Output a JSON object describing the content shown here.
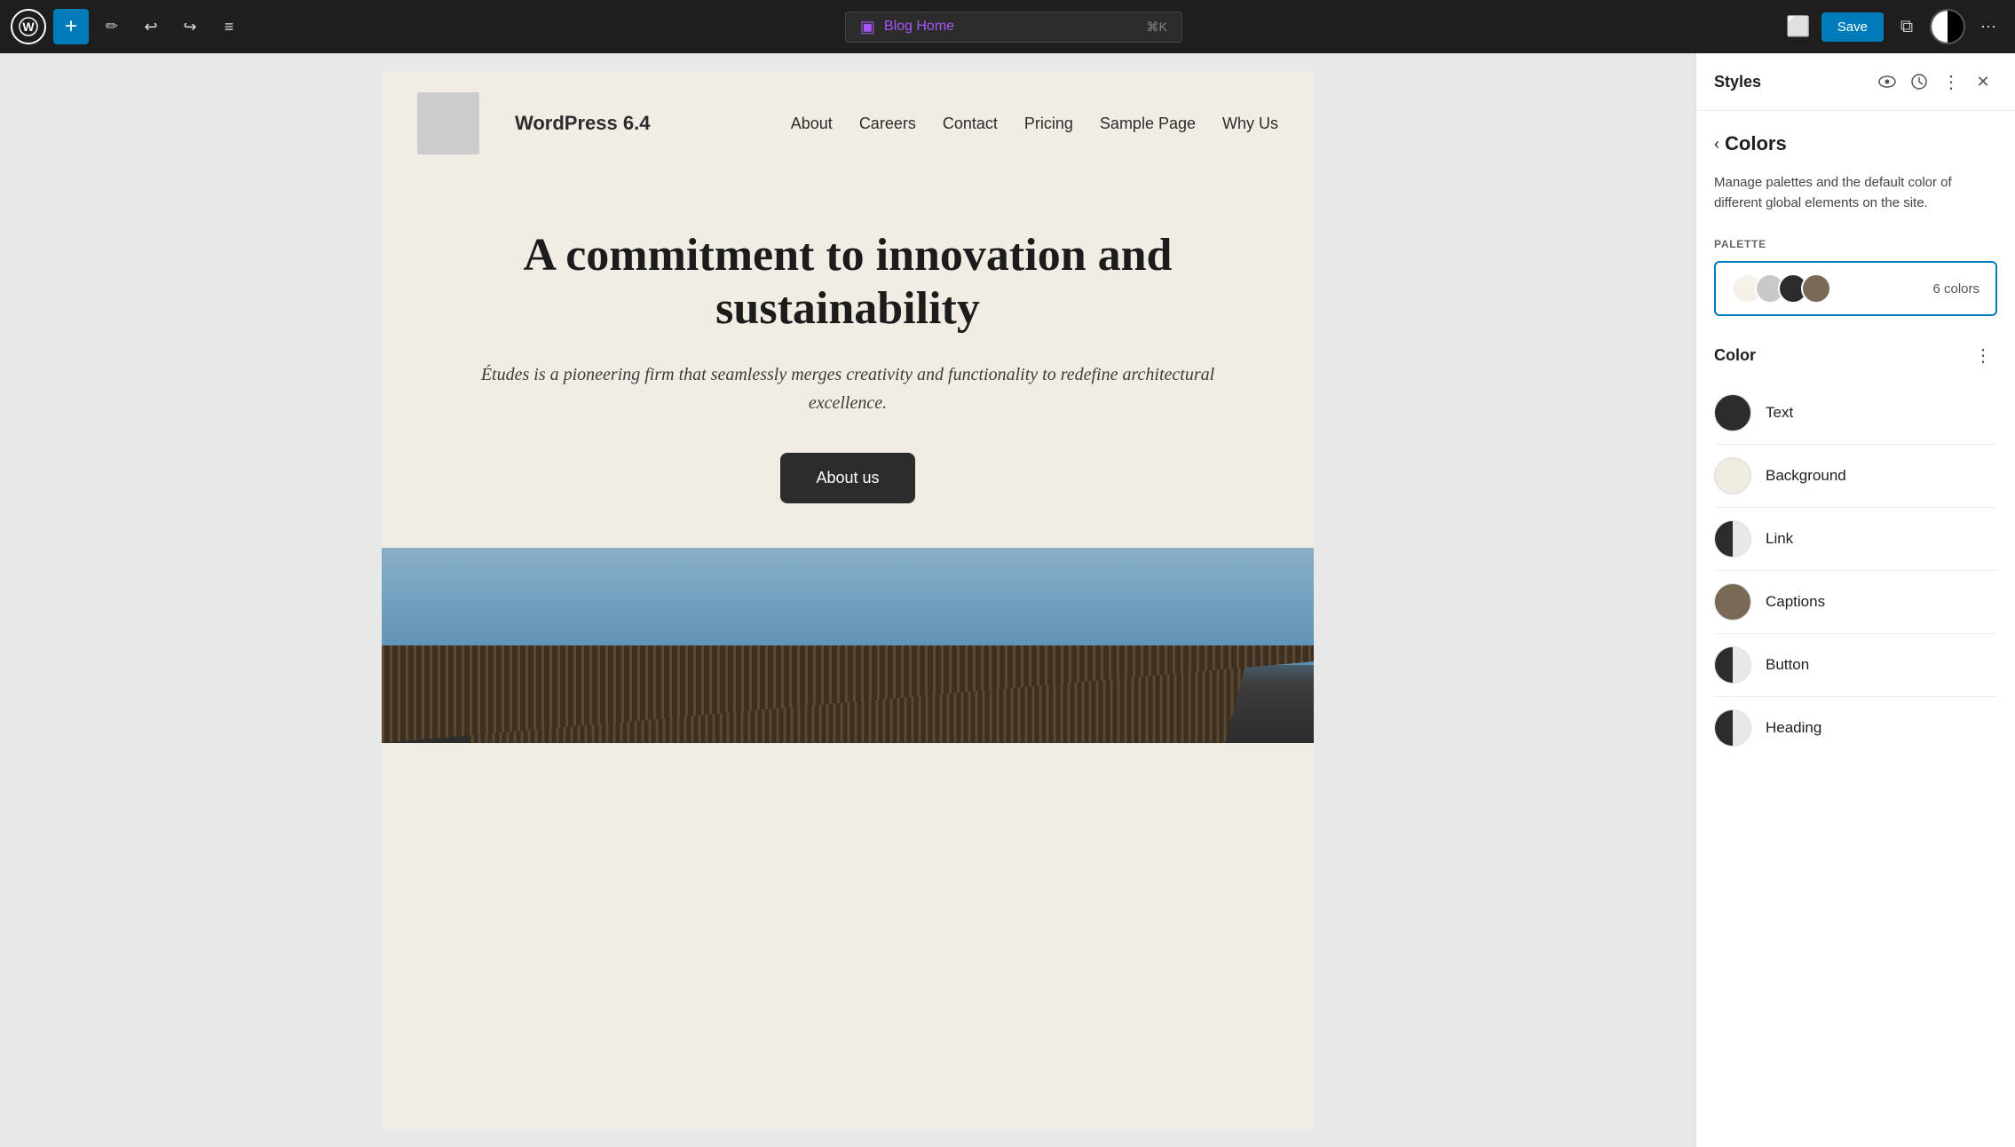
{
  "toolbar": {
    "wp_logo": "W",
    "add_label": "+",
    "url_icon": "▣",
    "url_text": "Blog Home",
    "url_shortcut": "⌘K",
    "save_label": "Save",
    "undo_icon": "↩",
    "redo_icon": "↪",
    "list_icon": "≡",
    "pen_icon": "✏",
    "desktop_icon": "□",
    "more_icon": "⋯"
  },
  "site": {
    "logo_alt": "Logo placeholder",
    "name": "WordPress 6.4",
    "nav_items": [
      "About",
      "Careers",
      "Contact",
      "Pricing",
      "Sample Page",
      "Why Us"
    ]
  },
  "hero": {
    "title": "A commitment to innovation and sustainability",
    "subtitle": "Études is a pioneering firm that seamlessly merges creativity and functionality to redefine architectural excellence.",
    "button_label": "About us"
  },
  "styles_panel": {
    "title": "Styles",
    "view_icon": "👁",
    "history_icon": "🕐",
    "more_icon": "⋯",
    "close_icon": "✕"
  },
  "colors_panel": {
    "back_label": "Colors",
    "description": "Manage palettes and the default color of different global elements on the site.",
    "palette_label": "PALETTE",
    "palette_count": "6 colors",
    "palette_circles": [
      {
        "color": "#f5f0e8"
      },
      {
        "color": "#c8c8c8"
      },
      {
        "color": "#2c2c2c"
      },
      {
        "color": "#7a6a55"
      }
    ],
    "color_section_title": "Color",
    "color_items": [
      {
        "id": "text",
        "label": "Text",
        "type": "solid",
        "color": "#2c2c2c"
      },
      {
        "id": "background",
        "label": "Background",
        "type": "solid",
        "color": "#f5f0e8"
      },
      {
        "id": "link",
        "label": "Link",
        "type": "dual",
        "color_left": "#2c2c2c",
        "color_right": "#e8e8e8"
      },
      {
        "id": "captions",
        "label": "Captions",
        "type": "solid",
        "color": "#7a6a55"
      },
      {
        "id": "button",
        "label": "Button",
        "type": "dual",
        "color_left": "#2c2c2c",
        "color_right": "#e8e8e8"
      },
      {
        "id": "heading",
        "label": "Heading",
        "type": "dual",
        "color_left": "#2c2c2c",
        "color_right": "#e8e8e8"
      }
    ]
  }
}
